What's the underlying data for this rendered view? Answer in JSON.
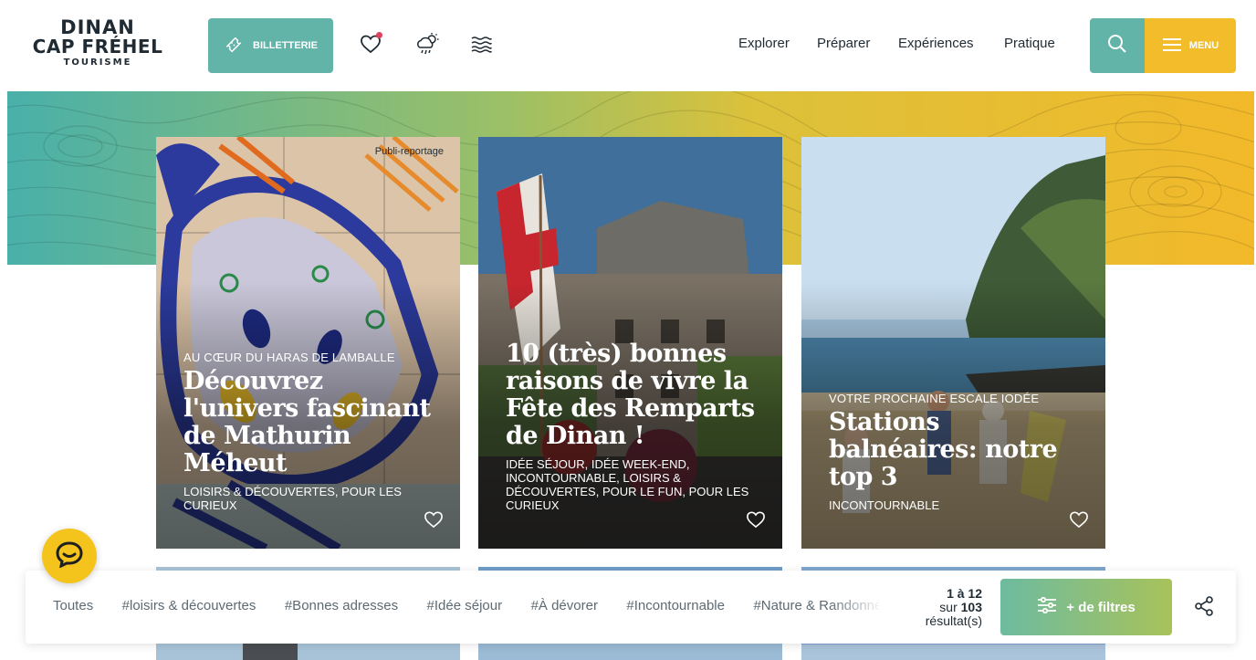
{
  "header": {
    "logo": {
      "line1": "DINAN",
      "line2": "CAP FRÉHEL",
      "line3": "TOURISME"
    },
    "ticket_label": "BILLETTERIE",
    "nav": [
      "Explorer",
      "Préparer",
      "Expériences",
      "Pratique"
    ],
    "menu_label": "MENU",
    "icons": {
      "ticket": "ticket-icon",
      "favorites": "heart-icon",
      "weather": "weather-icon",
      "tides": "waves-icon",
      "search": "search-icon",
      "menu": "hamburger-icon"
    }
  },
  "colors": {
    "teal": "#62b3a8",
    "yellow": "#f2bc2b",
    "favorite_dot": "#e0415f"
  },
  "cards": [
    {
      "badge": "Publi-reportage",
      "kicker": "AU CŒUR DU HARAS DE LAMBALLE",
      "title": "Découvrez l'univers fascinant de Mathurin Méheut",
      "tags": "LOISIRS & DÉCOUVERTES, POUR LES CURIEUX"
    },
    {
      "kicker": "",
      "title": "10 (très) bonnes raisons de vivre la Fête des Remparts de Dinan !",
      "tags": "IDÉE SÉJOUR, IDÉE WEEK-END, INCONTOURNABLE, LOISIRS & DÉCOUVERTES, POUR LE FUN, POUR LES CURIEUX"
    },
    {
      "kicker": "VOTRE PROCHAINE ESCALE IODÉE",
      "title": "Stations balnéaires: notre top 3",
      "tags": "INCONTOURNABLE"
    }
  ],
  "filterbar": {
    "filters": [
      "Toutes",
      "#loisirs & découvertes",
      "#Bonnes adresses",
      "#Idée séjour",
      "#À dévorer",
      "#Incontournable",
      "#Nature & Randonnée"
    ],
    "results": {
      "range": "1 à 12",
      "of_label": "sur",
      "total": "103",
      "suffix": "résultat(s)"
    },
    "more_filters_label": "+ de filtres"
  }
}
